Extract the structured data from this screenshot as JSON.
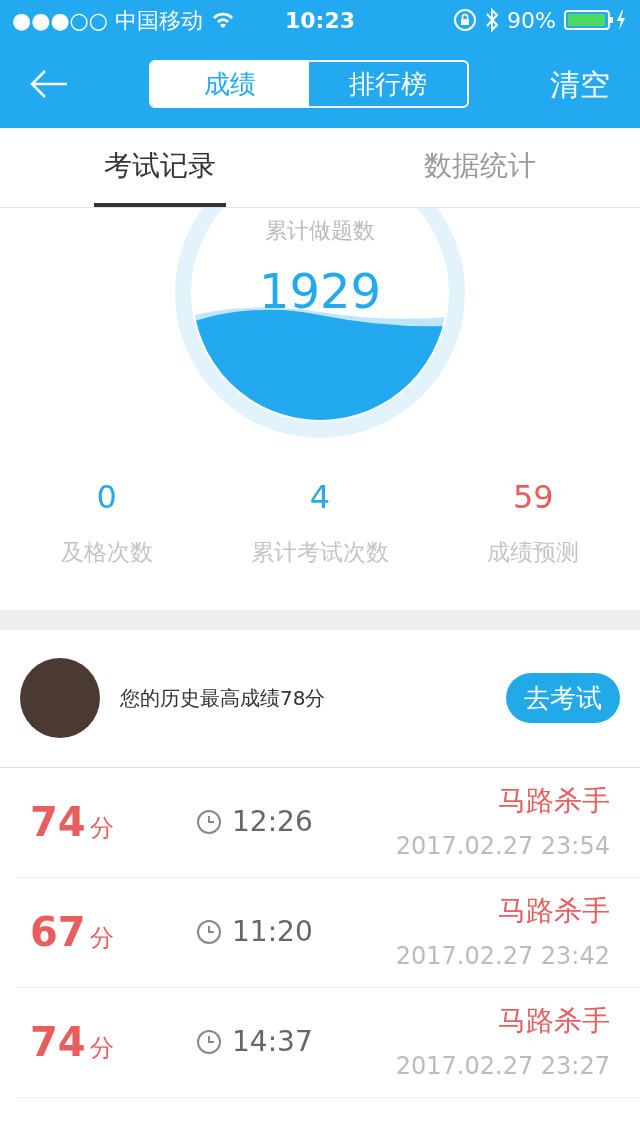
{
  "status_bar": {
    "carrier": "●●●○○ 中国移动",
    "time": "10:23",
    "battery": "90%"
  },
  "nav": {
    "segments": [
      {
        "label": "成绩",
        "selected": true
      },
      {
        "label": "排行榜",
        "selected": false
      }
    ],
    "action": "清空"
  },
  "tabs": [
    {
      "label": "考试记录",
      "selected": true
    },
    {
      "label": "数据统计",
      "selected": false
    }
  ],
  "gauge": {
    "label": "累计做题数",
    "value": "1929"
  },
  "stats": [
    {
      "value": "0",
      "label": "及格次数",
      "color": "#2aa7e8"
    },
    {
      "value": "4",
      "label": "累计考试次数",
      "color": "#2aa7e8"
    },
    {
      "value": "59",
      "label": "成绩预测",
      "color": "#e85d5d"
    }
  ],
  "best": {
    "text": "您的历史最高成绩78分",
    "button": "去考试"
  },
  "records": [
    {
      "score": "74",
      "unit": "分",
      "duration": "12:26",
      "title": "马路杀手",
      "date": "2017.02.27 23:54"
    },
    {
      "score": "67",
      "unit": "分",
      "duration": "11:20",
      "title": "马路杀手",
      "date": "2017.02.27 23:42"
    },
    {
      "score": "74",
      "unit": "分",
      "duration": "14:37",
      "title": "马路杀手",
      "date": "2017.02.27 23:27"
    }
  ]
}
